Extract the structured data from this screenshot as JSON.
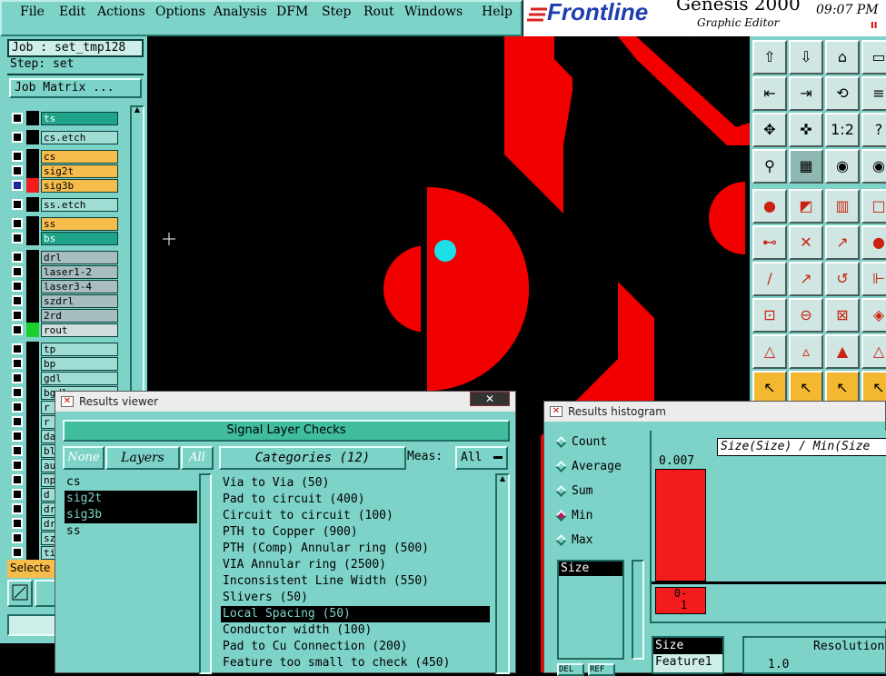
{
  "menu": [
    "File",
    "Edit",
    "Actions",
    "Options",
    "Analysis",
    "DFM",
    "Step",
    "Rout",
    "Windows",
    "Help"
  ],
  "logo": {
    "brand": "Frontline",
    "product": "Genesis 2000",
    "subtitle": "Graphic Editor",
    "time": "09:07 PM",
    "ticker": "II"
  },
  "job": {
    "job_field": "Job : set_tmp128",
    "step_field": "Step: set",
    "matrix_button": "Job Matrix ..."
  },
  "layers": [
    {
      "name": "ts",
      "color": "#1fa489"
    },
    {
      "name": "cs.etch",
      "color": "#9fdcd4"
    },
    {
      "name": "cs",
      "color": "#f6bd4c"
    },
    {
      "name": "sig2t",
      "color": "#f6bd4c"
    },
    {
      "name": "sig3b",
      "color": "#f6bd4c"
    },
    {
      "name": "ss.etch",
      "color": "#9fdcd4"
    },
    {
      "name": "ss",
      "color": "#f6bd4c"
    },
    {
      "name": "bs",
      "color": "#1fa489"
    },
    {
      "name": "drl",
      "color": "#a8bdc0"
    },
    {
      "name": "laser1-2",
      "color": "#a8bdc0"
    },
    {
      "name": "laser3-4",
      "color": "#a8bdc0"
    },
    {
      "name": "szdrl",
      "color": "#a8bdc0"
    },
    {
      "name": "2rd",
      "color": "#a8bdc0"
    },
    {
      "name": "rout",
      "color": "#cfdedd"
    },
    {
      "name": "tp",
      "color": "#9fdcd4"
    },
    {
      "name": "bp",
      "color": "#9fdcd4"
    },
    {
      "name": "gdl",
      "color": "#9fdcd4"
    },
    {
      "name": "bgdl",
      "color": "#9fdcd4"
    },
    {
      "name": "r",
      "color": "#9fdcd4"
    },
    {
      "name": "r",
      "color": "#9fdcd4"
    },
    {
      "name": "da",
      "color": "#9fdcd4"
    },
    {
      "name": "bl",
      "color": "#9fdcd4"
    },
    {
      "name": "au",
      "color": "#9fdcd4"
    },
    {
      "name": "np",
      "color": "#9fdcd4"
    },
    {
      "name": "d",
      "color": "#9fdcd4"
    },
    {
      "name": "dr",
      "color": "#9fdcd4"
    },
    {
      "name": "dr",
      "color": "#9fdcd4"
    },
    {
      "name": "sz",
      "color": "#9fdcd4"
    },
    {
      "name": "ti",
      "color": "#9fdcd4"
    }
  ],
  "selected_label": "Selecte",
  "results_viewer": {
    "title": "Results viewer",
    "header": "Signal Layer Checks",
    "none": "None",
    "layers": "Layers",
    "all": "All",
    "categories": "Categories (12)",
    "meas": "Meas:",
    "meas_value": "All",
    "layer_items": [
      "cs",
      "sig2t",
      "sig3b",
      "ss"
    ],
    "category_items": [
      "Via to Via (50)",
      "Pad to circuit (400)",
      "Circuit to circuit (100)",
      "PTH to Copper (900)",
      "PTH (Comp) Annular ring (500)",
      "VIA Annular ring (2500)",
      "Inconsistent Line Width (550)",
      "Slivers (50)",
      "Local Spacing (50)",
      "Conductor width (100)",
      "Pad to Cu Connection (200)",
      "Feature too small to check (450)"
    ]
  },
  "histogram": {
    "title": "Results histogram",
    "options": [
      "Count",
      "Average",
      "Sum",
      "Min",
      "Max"
    ],
    "selected_option": "Min",
    "size_item": "Size",
    "chart_label": "Size(Size) / Min(Size",
    "bar_value": "0.007",
    "bin_label": "0-\n 1",
    "table_col1": [
      "Size",
      "Feature1"
    ],
    "resolution_label": "Resolution",
    "resolution_value": "1.0",
    "btn1": "DEL",
    "btn2": "REF"
  }
}
